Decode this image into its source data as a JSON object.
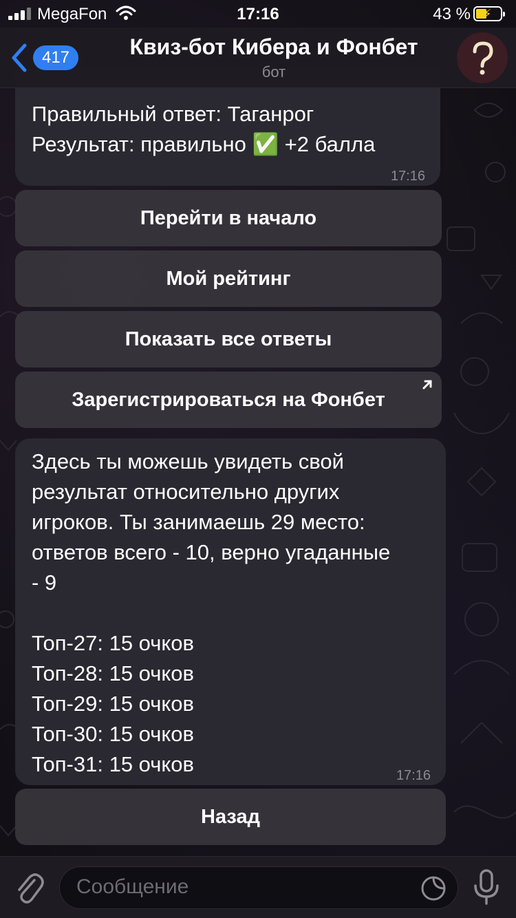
{
  "status_bar": {
    "carrier": "MegaFon",
    "time": "17:16",
    "battery_percent": "43 %"
  },
  "header": {
    "back_count": "417",
    "title": "Квиз-бот Кибера и Фонбет",
    "subtitle": "бот",
    "avatar_icon": "question-mark-icon"
  },
  "messages": [
    {
      "lines": [
        "Правильный ответ: Таганрог",
        "Результат: правильно ✅ +2 балла"
      ],
      "time": "17:16"
    },
    {
      "text": "Здесь ты можешь увидеть свой\nрезультат относительно других\nигроков. Ты занимаешь 29 место:\nответов всего - 10, верно угаданные\n- 9\n\nТоп-27: 15 очков\nТоп-28: 15 очков\nТоп-29: 15 очков\nТоп-30: 15 очков\nТоп-31: 15 очков",
      "time": "17:16"
    }
  ],
  "keyboard_1": {
    "buttons": [
      "Перейти в начало",
      "Мой рейтинг",
      "Показать все ответы",
      "Зарегистрироваться на Фонбет"
    ]
  },
  "keyboard_2": {
    "buttons": [
      "Назад"
    ]
  },
  "input": {
    "placeholder": "Сообщение"
  },
  "colors": {
    "accent": "#2f7ff2",
    "bubble": "#2a2830",
    "button": "#3a373e",
    "battery": "#f6d21c"
  }
}
